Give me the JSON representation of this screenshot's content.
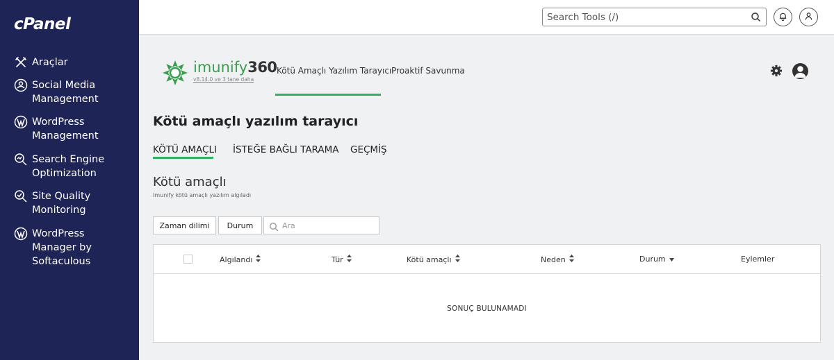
{
  "sidebar": {
    "logo": "cPanel",
    "items": [
      {
        "label": "Araçlar",
        "icon": "tools-icon"
      },
      {
        "label": "Social Media Management",
        "icon": "social-media-icon"
      },
      {
        "label": "WordPress Management",
        "icon": "wordpress-icon"
      },
      {
        "label": "Search Engine Optimization",
        "icon": "seo-icon"
      },
      {
        "label": "Site Quality Monitoring",
        "icon": "site-quality-icon"
      },
      {
        "label": "WordPress Manager by Softaculous",
        "icon": "wordpress-icon"
      }
    ]
  },
  "topbar": {
    "search_placeholder": "Search Tools (/)"
  },
  "imunify": {
    "name_prefix": "imunify",
    "name_suffix": "360",
    "version": "v8.14.0 ve 3 tane daha",
    "brand_color": "#3b9d4f",
    "tabs": [
      {
        "label": "Kötü Amaçlı Yazılım Tarayıcı",
        "active": true
      },
      {
        "label": "Proaktif Savunma",
        "active": false
      }
    ]
  },
  "page": {
    "title": "Kötü amaçlı yazılım tarayıcı",
    "tabs": [
      {
        "label": "KÖTÜ AMAÇLI",
        "active": true
      },
      {
        "label": "İSTEĞE BAĞLI TARAMA",
        "active": false
      },
      {
        "label": "GEÇMİŞ",
        "active": false
      }
    ],
    "section_title": "Kötü amaçlı",
    "section_subtitle": "Imunify kötü amaçlı yazılım algıladı"
  },
  "filters": {
    "time_button": "Zaman dilimi",
    "status_button": "Durum",
    "search_placeholder": "Ara"
  },
  "table": {
    "columns": [
      {
        "label": "Algılandı",
        "sort": "both"
      },
      {
        "label": "Tür",
        "sort": "both"
      },
      {
        "label": "Kötü amaçlı",
        "sort": "both"
      },
      {
        "label": "Neden",
        "sort": "both"
      },
      {
        "label": "Durum",
        "sort": "down"
      },
      {
        "label": "Eylemler",
        "sort": "none"
      }
    ],
    "empty_message": "SONUÇ BULUNAMADI"
  },
  "colors": {
    "sidebar_bg": "#1f2456",
    "accent_green": "#2fb062"
  }
}
